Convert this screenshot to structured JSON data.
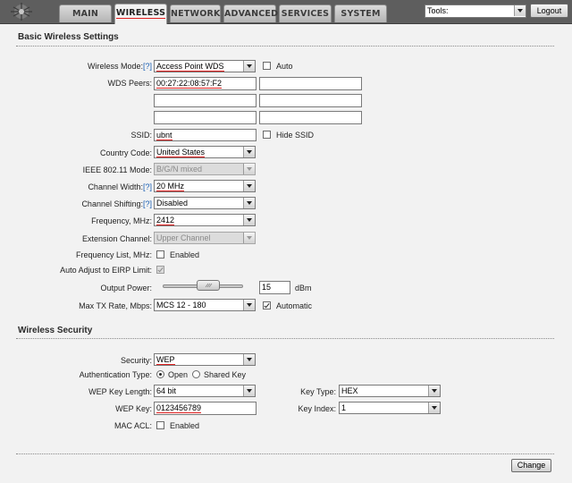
{
  "nav": {
    "tabs": [
      {
        "label": "MAIN"
      },
      {
        "label": "WIRELESS"
      },
      {
        "label": "NETWORK"
      },
      {
        "label": "ADVANCED"
      },
      {
        "label": "SERVICES"
      },
      {
        "label": "SYSTEM"
      }
    ],
    "active_tab": "WIRELESS",
    "tools_value": "Tools:",
    "logout_label": "Logout"
  },
  "basic": {
    "title": "Basic Wireless Settings",
    "wireless_mode_label": "Wireless Mode:",
    "help_marker": "[?]",
    "wireless_mode_value": "Access Point WDS",
    "auto_label": "Auto",
    "wds_peers_label": "WDS Peers:",
    "wds_peers": [
      "00:27:22:08:57:F2",
      "",
      "",
      "",
      "",
      ""
    ],
    "ssid_label": "SSID:",
    "ssid_value": "ubnt",
    "hide_ssid_label": "Hide SSID",
    "country_label": "Country Code:",
    "country_value": "United States",
    "ieee_label": "IEEE 802.11 Mode:",
    "ieee_value": "B/G/N mixed",
    "channel_width_label": "Channel Width:",
    "channel_width_value": "20 MHz",
    "channel_shift_label": "Channel Shifting:",
    "channel_shift_value": "Disabled",
    "frequency_label": "Frequency, MHz:",
    "frequency_value": "2412",
    "ext_channel_label": "Extension Channel:",
    "ext_channel_value": "Upper Channel",
    "freq_list_label": "Frequency List, MHz:",
    "freq_list_enabled_label": "Enabled",
    "auto_eirp_label": "Auto Adjust to EIRP Limit:",
    "output_power_label": "Output Power:",
    "output_power_value": "15",
    "output_power_unit": "dBm",
    "output_power_slider_fraction": 0.6,
    "max_tx_label": "Max TX Rate, Mbps:",
    "max_tx_value": "MCS 12 - 180",
    "automatic_label": "Automatic"
  },
  "security": {
    "title": "Wireless Security",
    "security_label": "Security:",
    "security_value": "WEP",
    "auth_type_label": "Authentication Type:",
    "auth_open_label": "Open",
    "auth_shared_label": "Shared Key",
    "wep_length_label": "WEP Key Length:",
    "wep_length_value": "64 bit",
    "key_type_label": "Key Type:",
    "key_type_value": "HEX",
    "wep_key_label": "WEP Key:",
    "wep_key_value": "0123456789",
    "key_index_label": "Key Index:",
    "key_index_value": "1",
    "mac_acl_label": "MAC ACL:",
    "mac_acl_enabled_label": "Enabled"
  },
  "footer": {
    "change_label": "Change"
  },
  "colors": {
    "highlight_underline": "#e02020",
    "help_link": "#1a5fb4",
    "topbar": "#5e5e5e"
  }
}
